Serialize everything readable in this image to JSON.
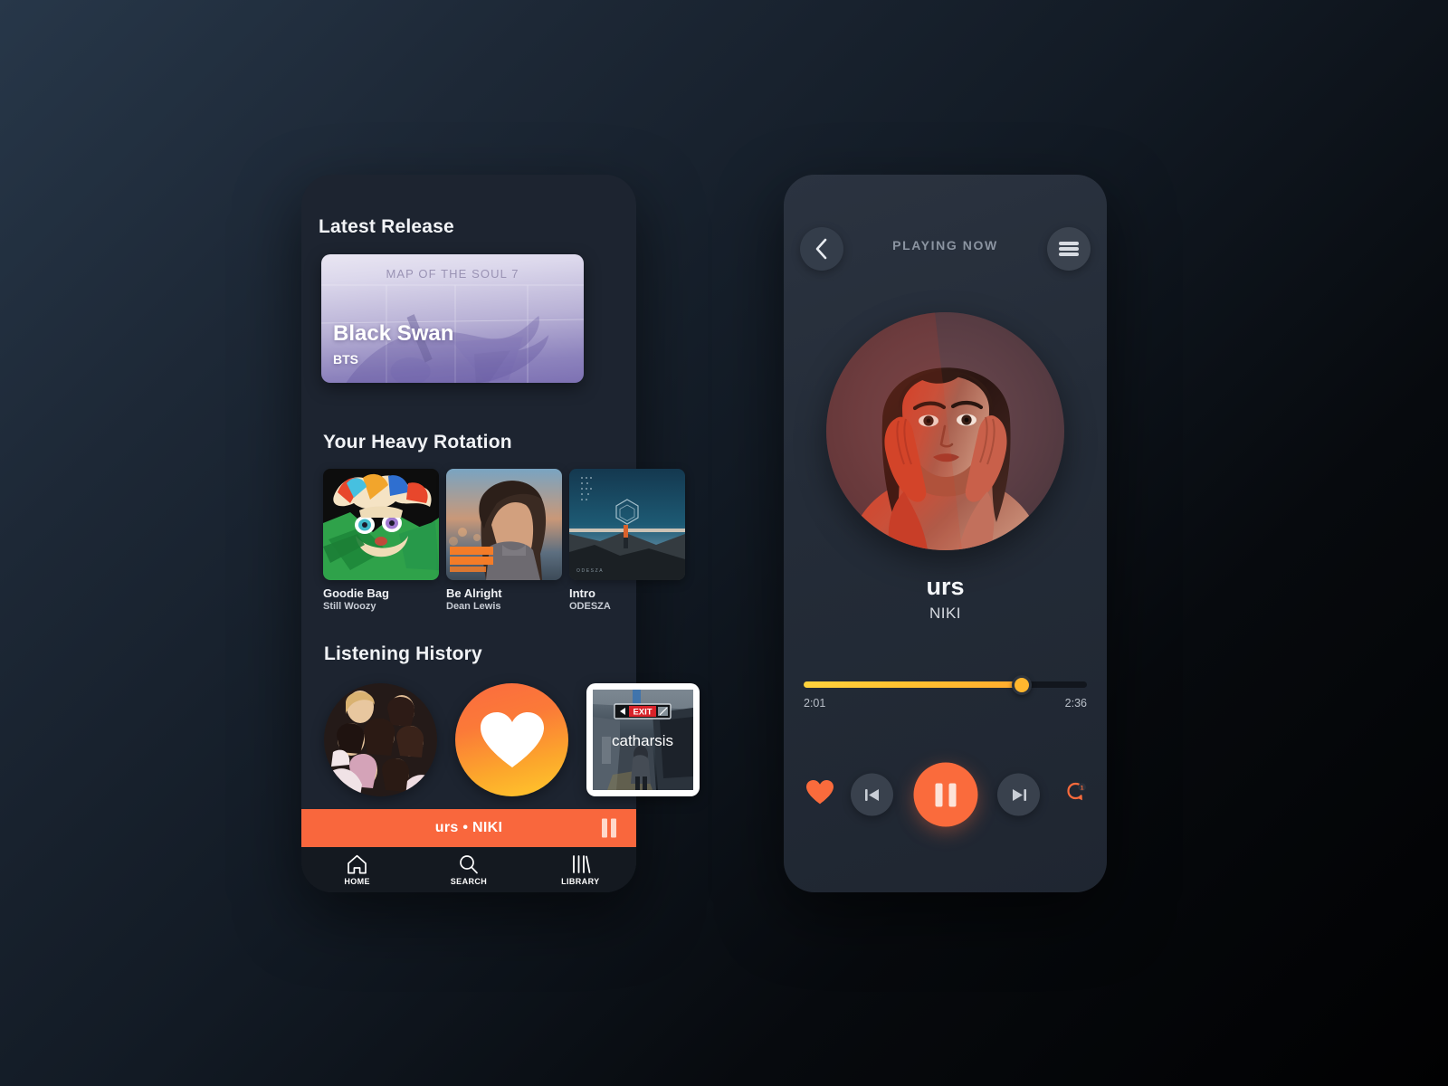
{
  "theme": {
    "accent_orange": "#fa6b3c",
    "accent_yellow": "#ffc230",
    "panel_dark": "#1d2430",
    "panel_right": "#2b3340",
    "nav_bar": "#141920",
    "background_from": "#273749",
    "background_to": "#010102"
  },
  "home": {
    "latest_release": {
      "heading": "Latest Release",
      "album_banner_text": "MAP OF THE SOUL  7",
      "song": "Black Swan",
      "artist": "BTS"
    },
    "heavy_rotation": {
      "heading": "Your Heavy Rotation",
      "items": [
        {
          "song": "Goodie Bag",
          "artist": "Still Woozy",
          "art": "goodie-bag-cover"
        },
        {
          "song": "Be Alright",
          "artist": "Dean Lewis",
          "art": "be-alright-cover"
        },
        {
          "song": "Intro",
          "artist": "ODESZA",
          "art": "odesza-intro-cover"
        }
      ]
    },
    "listening_history": {
      "heading": "Listening History",
      "items": [
        {
          "name": "girl-group-photo",
          "type": "circle-photo"
        },
        {
          "name": "liked-songs",
          "type": "heart-gradient"
        },
        {
          "name": "catharsis",
          "type": "album-card",
          "label": "catharsis",
          "sign_text": "EXIT"
        }
      ]
    },
    "mini_player": {
      "song": "urs",
      "separator": "•",
      "artist": "NIKI",
      "text": "urs • NIKI",
      "state": "playing",
      "button_icon": "pause-icon"
    },
    "bottom_nav": [
      {
        "label": "HOME",
        "icon": "home-icon",
        "active": true
      },
      {
        "label": "SEARCH",
        "icon": "search-icon",
        "active": false
      },
      {
        "label": "LIBRARY",
        "icon": "library-icon",
        "active": false
      }
    ]
  },
  "player": {
    "header": {
      "title": "PLAYING NOW",
      "back_icon": "chevron-left-icon",
      "menu_icon": "hamburger-menu-icon"
    },
    "artwork": "niki-portrait-red-light",
    "song": "urs",
    "artist": "NIKI",
    "progress": {
      "current_time": "2:01",
      "total_time": "2:36",
      "percent": 77
    },
    "controls": {
      "like_icon": "heart-icon",
      "previous_icon": "skip-previous-icon",
      "play_pause_icon": "pause-icon",
      "next_icon": "skip-next-icon",
      "repeat_icon": "repeat-one-icon"
    }
  }
}
